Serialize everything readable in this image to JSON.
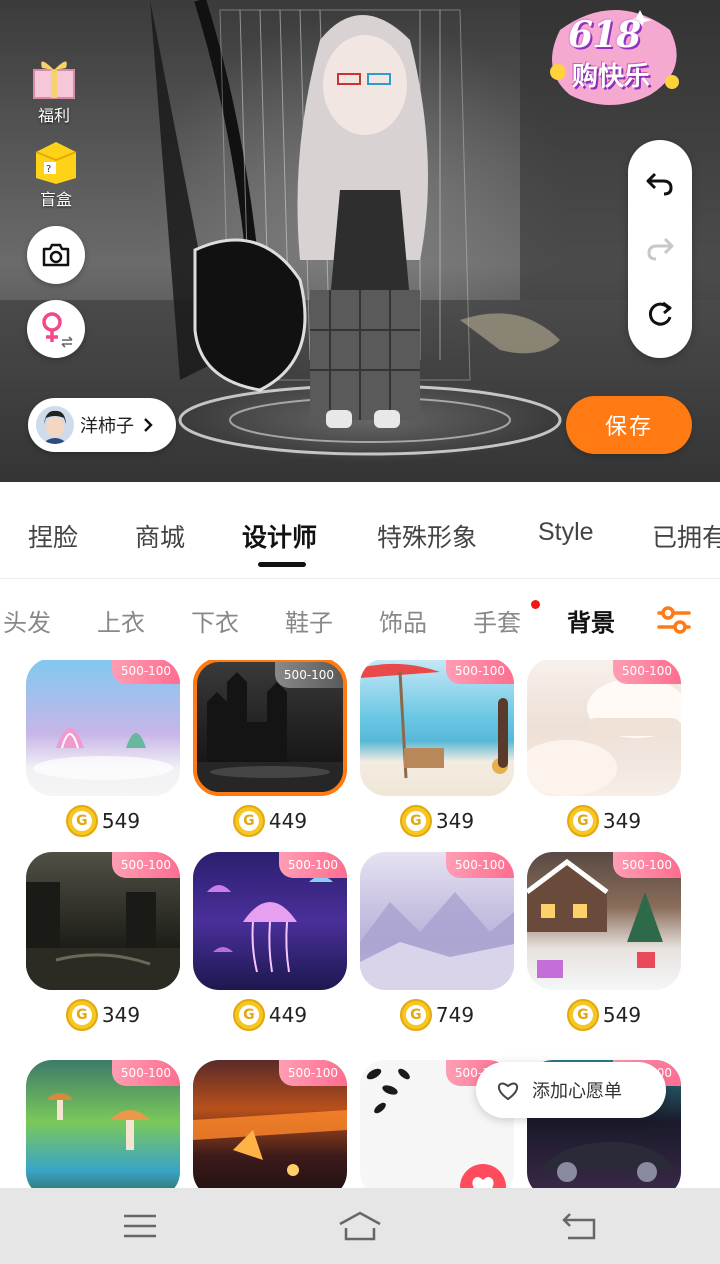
{
  "left_menu": {
    "welfare_label": "福利",
    "blindbox_label": "盲盒"
  },
  "promo_badge": {
    "top_text": "618",
    "bottom_text": "购快乐"
  },
  "user": {
    "name": "洋柿子"
  },
  "save_label": "保存",
  "main_tabs": [
    "捏脸",
    "商城",
    "设计师",
    "特殊形象",
    "Style",
    "已拥有"
  ],
  "active_main_tab": "设计师",
  "sub_tabs": [
    "头发",
    "上衣",
    "下衣",
    "鞋子",
    "饰品",
    "手套",
    "背景"
  ],
  "active_sub_tab": "背景",
  "promo_tag": "500-100",
  "items": [
    {
      "price": "549",
      "scene": "underwater-seashell",
      "colors": [
        "#8fd3f4",
        "#d4b7e8",
        "#f2f2f2"
      ]
    },
    {
      "price": "449",
      "scene": "dark-castle",
      "colors": [
        "#1f1f1f",
        "#555555",
        "#2a2a2a"
      ],
      "selected": true
    },
    {
      "price": "349",
      "scene": "beach",
      "colors": [
        "#bfe6f5",
        "#62c4e0",
        "#f3ece2"
      ]
    },
    {
      "price": "349",
      "scene": "fluffy-white-room",
      "colors": [
        "#f6ede6",
        "#e8d8cc",
        "#f8f3ef"
      ]
    },
    {
      "price": "349",
      "scene": "ruined-city-river",
      "colors": [
        "#3a3a30",
        "#23231e",
        "#121212"
      ]
    },
    {
      "price": "449",
      "scene": "jellyfish",
      "colors": [
        "#3b2a8f",
        "#d86be8",
        "#1a1650"
      ]
    },
    {
      "price": "749",
      "scene": "lavender-mountains",
      "colors": [
        "#d6d0ea",
        "#b7b0d8",
        "#eeeaf5"
      ]
    },
    {
      "price": "549",
      "scene": "snowy-cabin",
      "colors": [
        "#7a5a4a",
        "#e4ddd8",
        "#f2f4f7"
      ]
    },
    {
      "price": "",
      "scene": "mushroom-forest",
      "colors": [
        "#2b6d5a",
        "#8fd46a",
        "#39a6c8"
      ]
    },
    {
      "price": "",
      "scene": "lava-field",
      "colors": [
        "#3c1a1a",
        "#e0531a",
        "#ffb347"
      ]
    },
    {
      "price": "",
      "scene": "white-with-leaves",
      "colors": [
        "#ffffff",
        "#f1f1f1",
        "#1a1a1a"
      ]
    },
    {
      "price": "",
      "scene": "sports-car",
      "colors": [
        "#1a1a2a",
        "#3d2a4a",
        "#8a8aa0"
      ]
    }
  ],
  "wish_label": "添加心愿单",
  "icons": {
    "camera": "camera-icon",
    "gender": "gender-switch-icon",
    "undo": "undo-icon",
    "redo": "redo-icon",
    "reset": "reset-icon",
    "filter": "filter-icon",
    "heart": "heart-icon",
    "coin": "coin-icon"
  },
  "accent_color": "#ff7a12"
}
